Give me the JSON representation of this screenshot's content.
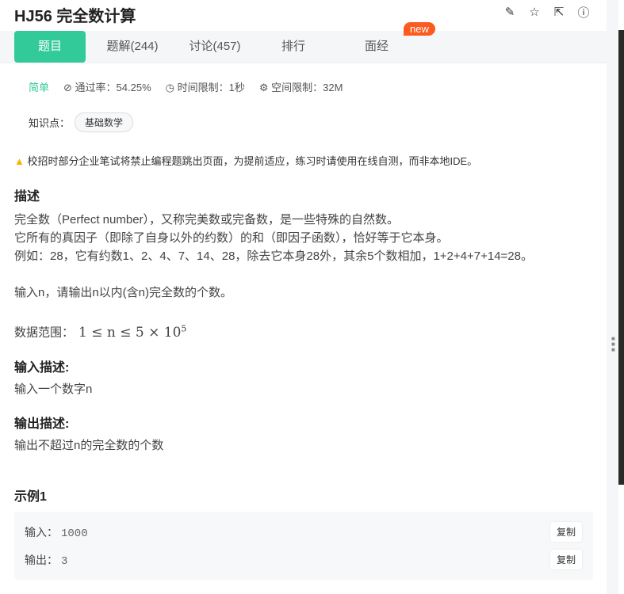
{
  "header": {
    "title": "HJ56  完全数计算",
    "icons": [
      "edit-icon",
      "star-icon",
      "share-icon",
      "report-icon"
    ]
  },
  "tabs": [
    {
      "label": "题目"
    },
    {
      "label": "题解(244)"
    },
    {
      "label": "讨论(457)"
    },
    {
      "label": "排行"
    },
    {
      "label": "面经"
    }
  ],
  "new_badge": "new",
  "meta": {
    "difficulty": "简单",
    "pass_rate": "通过率：54.25%",
    "time_limit": "时间限制：1秒",
    "space_limit": "空间限制：32M"
  },
  "knowledge": {
    "label": "知识点：",
    "tag": "基础数学"
  },
  "warning": "校招时部分企业笔试将禁止编程题跳出页面，为提前适应，练习时请使用在线自测，而非本地IDE。",
  "description": {
    "heading": "描述",
    "lines": [
      "完全数（Perfect number），又称完美数或完备数，是一些特殊的自然数。",
      "它所有的真因子（即除了自身以外的约数）的和（即因子函数），恰好等于它本身。",
      "例如：28，它有约数1、2、4、7、14、28，除去它本身28外，其余5个数相加，1+2+4+7+14=28。",
      "输入n，请输出n以内(含n)完全数的个数。"
    ],
    "range_label": "数据范围：",
    "range_math": "1 ≤ n ≤ 5 × 10",
    "range_exp": "5"
  },
  "input_desc": {
    "heading": "输入描述:",
    "text": "输入一个数字n"
  },
  "output_desc": {
    "heading": "输出描述:",
    "text": "输出不超过n的完全数的个数"
  },
  "example": {
    "heading": "示例1",
    "input_label": "输入：",
    "input": "1000",
    "output_label": "输出：",
    "output": "3",
    "copy": "复制"
  }
}
